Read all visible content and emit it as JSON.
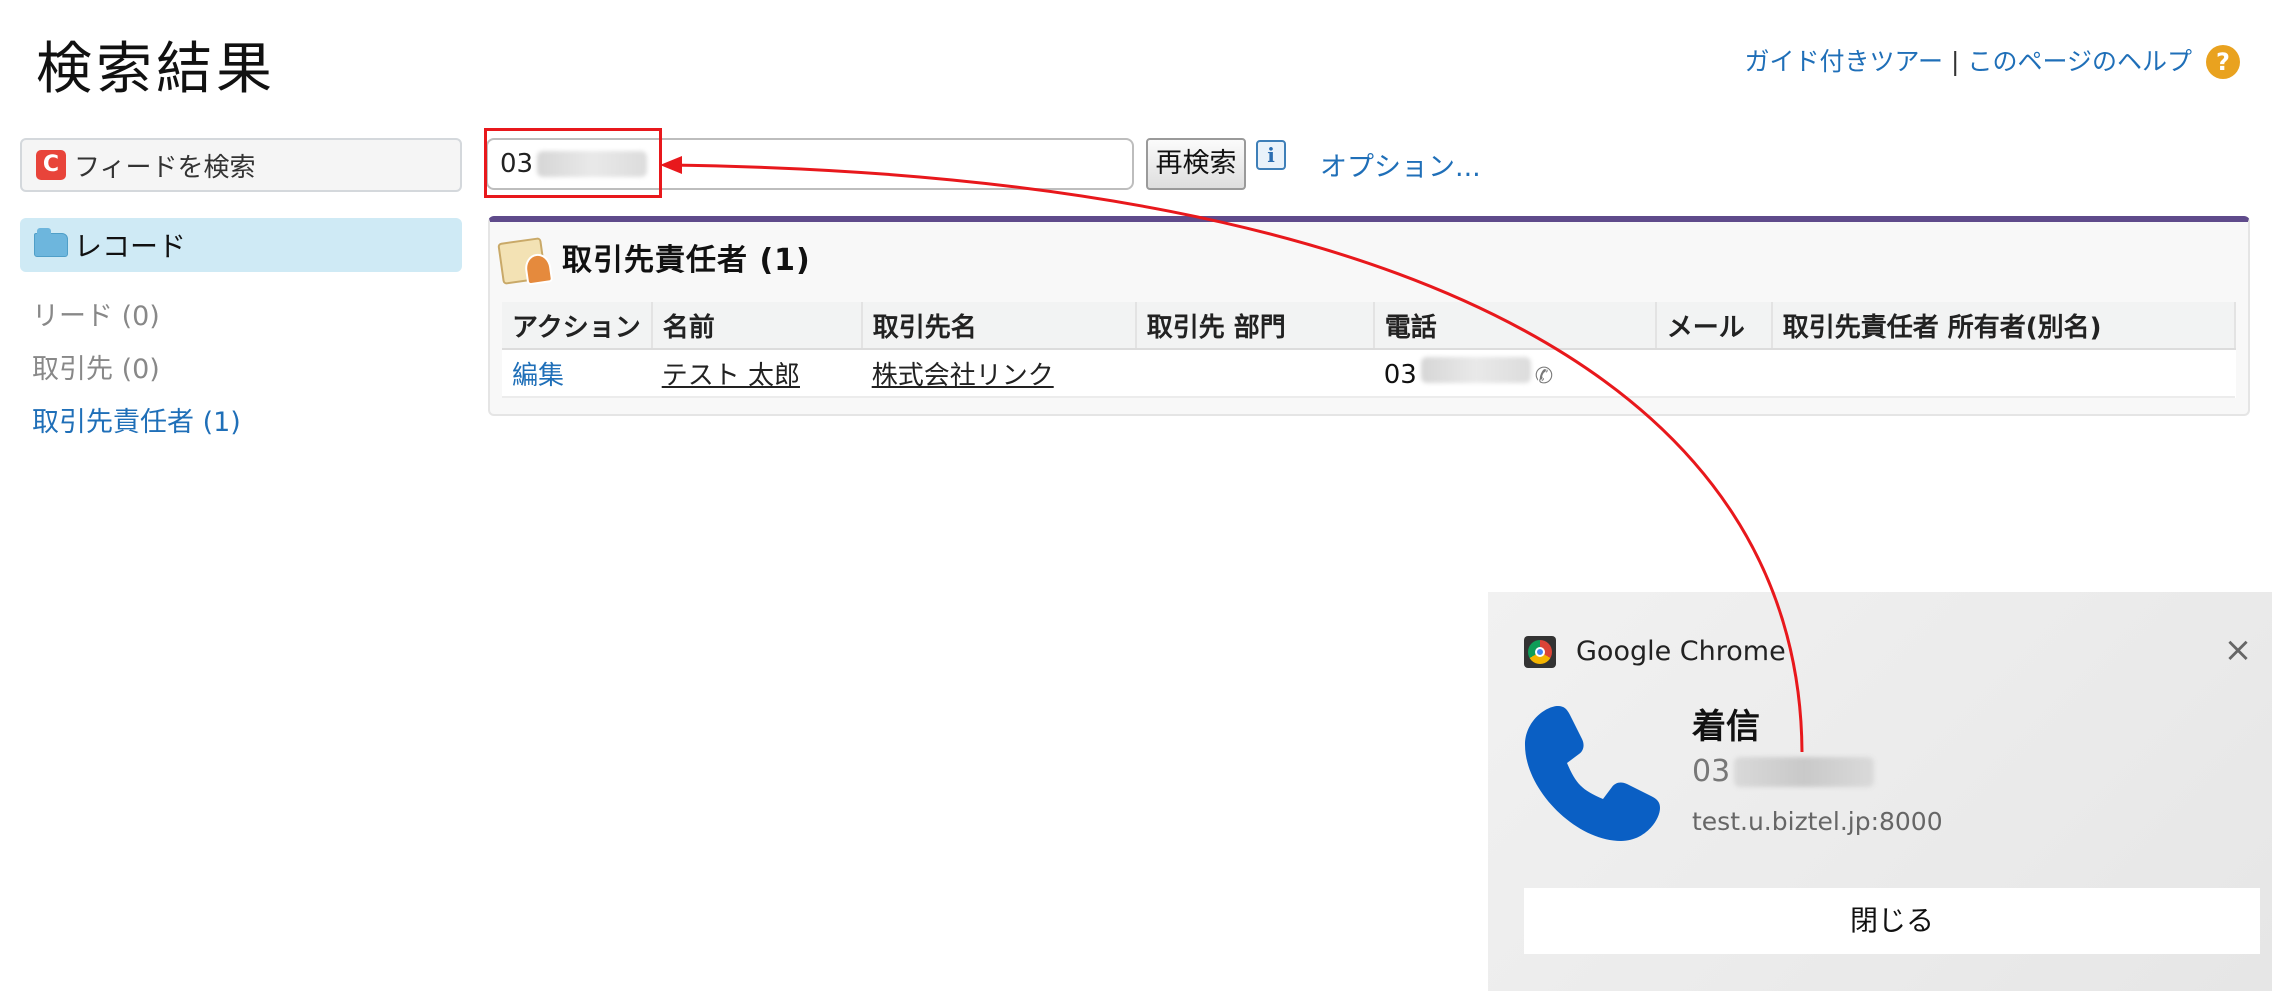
{
  "header": {
    "title": "検索結果",
    "guided_tour": "ガイド付きツアー",
    "separator": "|",
    "page_help": "このページのヘルプ",
    "help_icon_glyph": "?"
  },
  "sidebar": {
    "feed_search_label": "フィードを検索",
    "feed_icon_glyph": "C",
    "records_label": "レコード",
    "links": [
      {
        "label": "リード (0)"
      },
      {
        "label": "取引先 (0)"
      },
      {
        "label": "取引先責任者 (1)"
      }
    ]
  },
  "search": {
    "value_prefix": "03",
    "button_label": "再検索",
    "info_glyph": "i",
    "options_label": "オプション..."
  },
  "results": {
    "title": "取引先責任者 (1)",
    "columns": [
      "アクション",
      "名前",
      "取引先名",
      "取引先 部門",
      "電話",
      "メール",
      "取引先責任者 所有者(別名)"
    ],
    "rows": [
      {
        "action": "編集",
        "name": "テスト 太郎",
        "account": "株式会社リンク",
        "department": "",
        "phone_prefix": "03",
        "email": "",
        "owner_alias": ""
      }
    ]
  },
  "notification": {
    "app_name": "Google Chrome",
    "close_glyph": "×",
    "title": "着信",
    "number_prefix": "03",
    "source": "test.u.biztel.jp:8000",
    "button_label": "閉じる"
  },
  "colors": {
    "link_blue": "#1f6fb8",
    "annotation_red": "#e8181c",
    "panel_accent": "#5f4b8b",
    "phone_blue": "#0a5fc4"
  },
  "icons": {
    "feed": "chatter-icon",
    "records": "folder-icon",
    "contact": "contact-card-icon",
    "phone_small": "phone-icon",
    "call": "phone-call-icon",
    "chrome": "chrome-icon"
  }
}
